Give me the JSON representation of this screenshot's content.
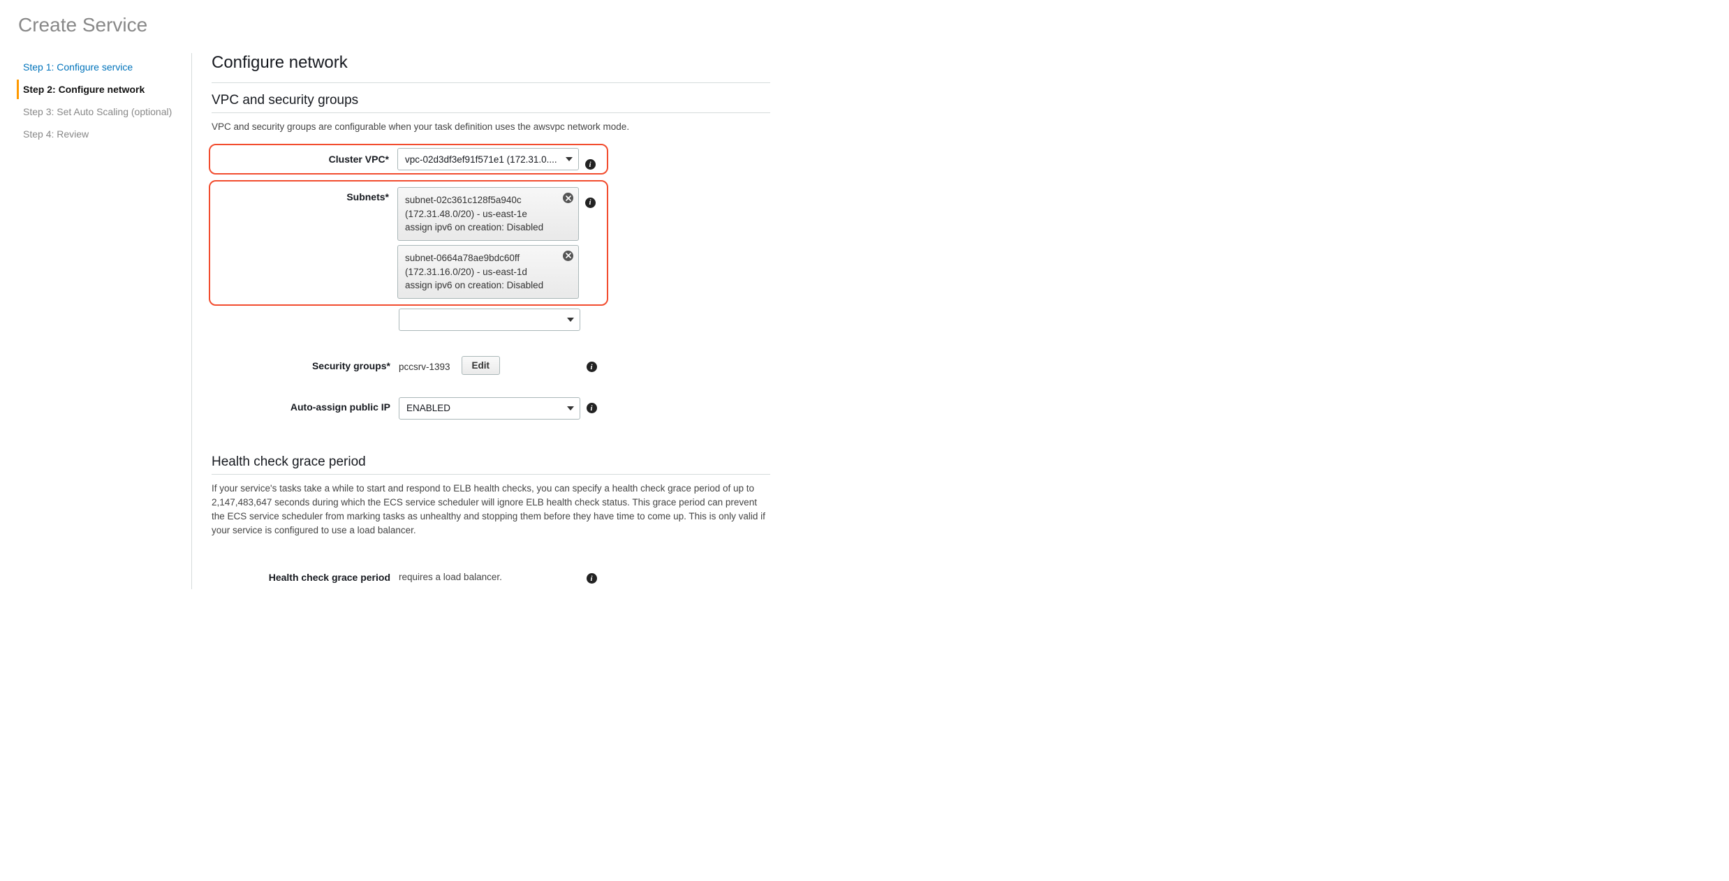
{
  "page": {
    "title": "Create Service"
  },
  "sidebar": {
    "items": [
      {
        "label": "Step 1: Configure service",
        "state": "link"
      },
      {
        "label": "Step 2: Configure network",
        "state": "active"
      },
      {
        "label": "Step 3: Set Auto Scaling (optional)",
        "state": "normal"
      },
      {
        "label": "Step 4: Review",
        "state": "normal"
      }
    ]
  },
  "main": {
    "heading": "Configure network",
    "vpc_section": {
      "heading": "VPC and security groups",
      "desc": "VPC and security groups are configurable when your task definition uses the awsvpc network mode.",
      "cluster_vpc": {
        "label": "Cluster VPC*",
        "value": "vpc-02d3df3ef91f571e1 (172.31.0...."
      },
      "subnets": {
        "label": "Subnets*",
        "chips": [
          {
            "id": "subnet-02c361c128f5a940c",
            "cidr_az": "(172.31.48.0/20) - us-east-1e",
            "ipv6": "assign ipv6 on creation: Disabled"
          },
          {
            "id": "subnet-0664a78ae9bdc60ff",
            "cidr_az": "(172.31.16.0/20) - us-east-1d",
            "ipv6": "assign ipv6 on creation: Disabled"
          }
        ],
        "add_placeholder": ""
      },
      "security_groups": {
        "label": "Security groups*",
        "value": "pccsrv-1393",
        "edit_label": "Edit"
      },
      "auto_assign_ip": {
        "label": "Auto-assign public IP",
        "value": "ENABLED"
      }
    },
    "health_section": {
      "heading": "Health check grace period",
      "desc": "If your service's tasks take a while to start and respond to ELB health checks, you can specify a health check grace period of up to 2,147,483,647 seconds during which the ECS service scheduler will ignore ELB health check status. This grace period can prevent the ECS service scheduler from marking tasks as unhealthy and stopping them before they have time to come up. This is only valid if your service is configured to use a load balancer.",
      "field_label": "Health check grace period",
      "field_value": "requires a load balancer."
    }
  }
}
